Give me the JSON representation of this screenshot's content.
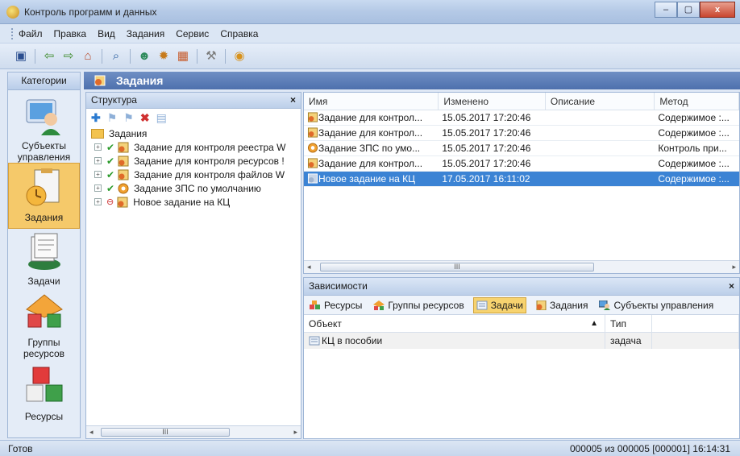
{
  "window": {
    "title": "Контроль программ и данных",
    "controls": [
      "–",
      "▢",
      "x"
    ]
  },
  "menu": [
    "Файл",
    "Правка",
    "Вид",
    "Задания",
    "Сервис",
    "Справка"
  ],
  "left_nav": {
    "header": "Категории",
    "items": [
      {
        "label": "Субъекты управления"
      },
      {
        "label": "Задания"
      },
      {
        "label": "Задачи"
      },
      {
        "label": "Группы ресурсов"
      },
      {
        "label": "Ресурсы"
      }
    ]
  },
  "main_header": "Задания",
  "structure": {
    "title": "Структура",
    "close": "×",
    "root": "Задания",
    "items": [
      {
        "label": "Задание для контроля реестра W",
        "state": "enabled"
      },
      {
        "label": "Задание для контроля ресурсов !",
        "state": "enabled"
      },
      {
        "label": "Задание для контроля файлов W",
        "state": "enabled"
      },
      {
        "label": "Задание ЗПС по умолчанию",
        "state": "enabled"
      },
      {
        "label": "Новое задание на КЦ",
        "state": "disabled"
      }
    ],
    "scroll_label": "III"
  },
  "list": {
    "columns": [
      "Имя",
      "Изменено",
      "Описание",
      "Метод"
    ],
    "rows": [
      {
        "name": "Задание для контрол...",
        "changed": "15.05.2017 17:20:46",
        "desc": "",
        "method": "Содержимое :...",
        "selected": false
      },
      {
        "name": "Задание для контрол...",
        "changed": "15.05.2017 17:20:46",
        "desc": "",
        "method": "Содержимое :...",
        "selected": false
      },
      {
        "name": "Задание ЗПС по умо...",
        "changed": "15.05.2017 17:20:46",
        "desc": "",
        "method": "Контроль при...",
        "selected": false
      },
      {
        "name": "Задание для контрол...",
        "changed": "15.05.2017 17:20:46",
        "desc": "",
        "method": "Содержимое :...",
        "selected": false
      },
      {
        "name": "Новое задание на КЦ",
        "changed": "17.05.2017 16:11:02",
        "desc": "",
        "method": "Содержимое :...",
        "selected": true
      }
    ],
    "scroll_label": "III"
  },
  "dependencies": {
    "title": "Зависимости",
    "close": "×",
    "tabs": [
      {
        "label": "Ресурсы",
        "active": false
      },
      {
        "label": "Группы ресурсов",
        "active": false
      },
      {
        "label": "Задачи",
        "active": true
      },
      {
        "label": "Задания",
        "active": false
      },
      {
        "label": "Субъекты управления",
        "active": false
      }
    ],
    "columns": [
      "Объект",
      "Тип"
    ],
    "sort_arrow": "▲",
    "rows": [
      {
        "object": "КЦ в пособии",
        "type": "задача"
      }
    ]
  },
  "status": {
    "left": "Готов",
    "right": "000005 из 000005 [000001]  16:14:31"
  }
}
